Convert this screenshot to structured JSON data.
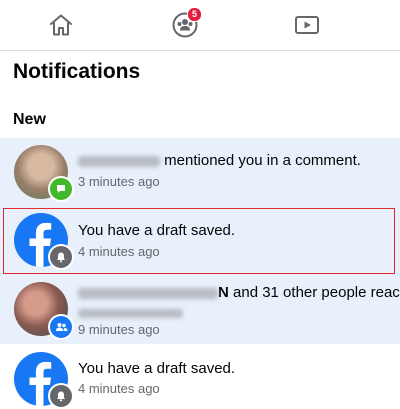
{
  "nav": {
    "groups_badge": "5",
    "icons": [
      "home-icon",
      "groups-icon",
      "watch-icon"
    ]
  },
  "page_title": "Notifications",
  "section_label": "New",
  "notifications": [
    {
      "name_redacted": true,
      "text": "mentioned you in a comment.",
      "time": "3 minutes ago",
      "badge_icon": "comment-icon"
    },
    {
      "text": "You have a draft saved.",
      "time": "4 minutes ago",
      "badge_icon": "bell-icon",
      "highlighted": true
    },
    {
      "name_redacted": true,
      "name_tail": "N",
      "text": " and 31 other people reac",
      "time": "9 minutes ago",
      "badge_icon": "groups-icon"
    },
    {
      "text": "You have a draft saved.",
      "time": "4 minutes ago",
      "badge_icon": "bell-icon"
    }
  ],
  "colors": {
    "unread_bg": "#e7f0fb",
    "facebook_blue": "#1877f2",
    "badge_red": "#e41e3f",
    "highlight_border": "#e0282e"
  }
}
